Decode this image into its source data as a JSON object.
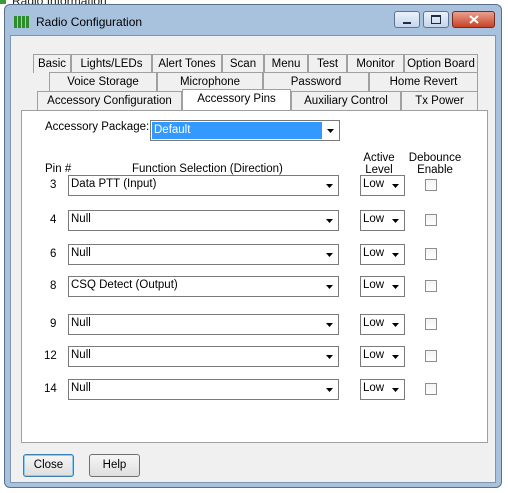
{
  "background_window": {
    "title": "Radio Information"
  },
  "window": {
    "title": "Radio Configuration"
  },
  "titlebar_buttons": {
    "minimize_icon": "minimize-icon",
    "maximize_icon": "maximize-icon",
    "close_icon": "close-icon"
  },
  "tabs": {
    "row1": [
      "Basic",
      "Lights/LEDs",
      "Alert Tones",
      "Scan",
      "Menu",
      "Test",
      "Monitor",
      "Option Board"
    ],
    "row2": [
      "Voice Storage",
      "Microphone",
      "Password",
      "Home Revert"
    ],
    "row3": [
      "Accessory Configuration",
      "Accessory Pins",
      "Auxiliary Control",
      "Tx Power"
    ],
    "selected": "Accessory Pins"
  },
  "accessory_package": {
    "label": "Accessory Package:",
    "value": "Default"
  },
  "headers": {
    "pin": "Pin #",
    "function": "Function Selection (Direction)",
    "active_level": "Active\nLevel",
    "debounce": "Debounce\nEnable"
  },
  "pins": [
    {
      "pin": "3",
      "function": "Data PTT (Input)",
      "level": "Low",
      "debounce": false
    },
    {
      "pin": "4",
      "function": "Null",
      "level": "Low",
      "debounce": false
    },
    {
      "pin": "6",
      "function": "Null",
      "level": "Low",
      "debounce": false
    },
    {
      "pin": "8",
      "function": "CSQ Detect (Output)",
      "level": "Low",
      "debounce": false
    },
    {
      "pin": "9",
      "function": "Null",
      "level": "Low",
      "debounce": false
    },
    {
      "pin": "12",
      "function": "Null",
      "level": "Low",
      "debounce": false
    },
    {
      "pin": "14",
      "function": "Null",
      "level": "Low",
      "debounce": false
    }
  ],
  "buttons": {
    "close": "Close",
    "help": "Help"
  },
  "colors": {
    "selection": "#3399ff",
    "frame": "#a8c2de",
    "close_button": "#c74326"
  }
}
